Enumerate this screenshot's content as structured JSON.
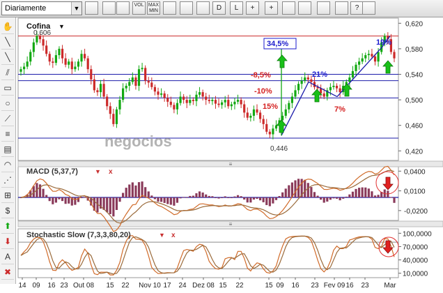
{
  "toolbar": {
    "period": "Diariamente",
    "buttons": [
      {
        "name": "bar-chart-icon",
        "text": ""
      },
      {
        "name": "candlestick-icon",
        "text": ""
      },
      {
        "name": "line-chart-icon",
        "text": ""
      },
      {
        "name": "volume-button",
        "text": "VOL"
      },
      {
        "name": "max-min-button",
        "text": "MAX MIN"
      },
      {
        "name": "grid-icon",
        "text": ""
      },
      {
        "name": "log-scale-icon",
        "text": ""
      },
      {
        "name": "calendar-icon",
        "text": ""
      },
      {
        "name": "draw-d-button",
        "text": "D"
      },
      {
        "name": "draw-l-button",
        "text": "L"
      },
      {
        "name": "crosshair-icon",
        "text": "+"
      },
      {
        "name": "crosshair-label-icon",
        "text": "+"
      },
      {
        "name": "trend-icon",
        "text": ""
      },
      {
        "name": "zoom-in-icon",
        "text": ""
      },
      {
        "name": "zoom-out-icon",
        "text": ""
      },
      {
        "name": "print-icon",
        "text": ""
      },
      {
        "name": "help-icon",
        "text": "?"
      },
      {
        "name": "book-icon",
        "text": ""
      }
    ]
  },
  "sidetools": [
    "hand-icon",
    "line-icon",
    "ray-icon",
    "parallel-lines-icon",
    "rectangle-icon",
    "circle-icon",
    "fibonacci-fan-icon",
    "fibonacci-retracement-icon",
    "fibonacci-levels-icon",
    "arc-icon",
    "speed-lines-icon",
    "gann-icon",
    "dollar-icon",
    "buy-arrow-icon",
    "sell-arrow-icon",
    "text-icon",
    "delete-icon"
  ],
  "price_panel": {
    "symbol": "Cofina",
    "max_label": "0,606",
    "min_label": "0,446",
    "watermark": "negocios",
    "annotations": {
      "gain_total": "34,5%",
      "gain_recent": "19%",
      "gain_rebound": "21%",
      "dip_7": "7%",
      "fall_85": "-8,5%",
      "fall_10": "-10%",
      "fall_15": "15%"
    }
  },
  "macd_panel": {
    "title": "MACD (5,37,7)"
  },
  "stoch_panel": {
    "title": "Stochastic Slow (7,3,3,80,20)"
  },
  "chart_data": [
    {
      "type": "candlestick",
      "title": "Cofina",
      "ylim": [
        0.405,
        0.628
      ],
      "yticks": [
        "0,420",
        "0,460",
        "0,500",
        "0,540",
        "0,580",
        "0,620"
      ],
      "xticks": [
        "14",
        "09",
        "16",
        "23",
        "Out 08",
        "15",
        "22",
        "Nov 10",
        "17",
        "24",
        "Dez 08",
        "15",
        "22",
        "15",
        "09",
        "16",
        "23",
        "Fev 09",
        "16",
        "23",
        "Mar"
      ],
      "horizontal_lines": [
        0.6,
        0.54,
        0.53,
        0.503,
        0.44
      ],
      "close": [
        0.548,
        0.552,
        0.56,
        0.575,
        0.59,
        0.6,
        0.595,
        0.585,
        0.572,
        0.56,
        0.558,
        0.57,
        0.58,
        0.565,
        0.555,
        0.56,
        0.548,
        0.552,
        0.56,
        0.572,
        0.565,
        0.548,
        0.532,
        0.515,
        0.512,
        0.525,
        0.505,
        0.49,
        0.478,
        0.462,
        0.485,
        0.5,
        0.518,
        0.522,
        0.528,
        0.535,
        0.522,
        0.548,
        0.55,
        0.53,
        0.527,
        0.52,
        0.513,
        0.508,
        0.51,
        0.503,
        0.497,
        0.492,
        0.485,
        0.495,
        0.505,
        0.5,
        0.495,
        0.5,
        0.498,
        0.508,
        0.512,
        0.505,
        0.5,
        0.498,
        0.5,
        0.494,
        0.492,
        0.496,
        0.5,
        0.49,
        0.493,
        0.497,
        0.5,
        0.493,
        0.48,
        0.472,
        0.475,
        0.485,
        0.48,
        0.47,
        0.462,
        0.45,
        0.446,
        0.455,
        0.46,
        0.468,
        0.475,
        0.485,
        0.495,
        0.505,
        0.515,
        0.525,
        0.53,
        0.535,
        0.532,
        0.528,
        0.52,
        0.518,
        0.51,
        0.505,
        0.515,
        0.52,
        0.522,
        0.518,
        0.512,
        0.522,
        0.528,
        0.535,
        0.545,
        0.555,
        0.56,
        0.565,
        0.57,
        0.572,
        0.568,
        0.56,
        0.575,
        0.59,
        0.6,
        0.595,
        0.575,
        0.565
      ]
    },
    {
      "type": "line",
      "title": "MACD (5,37,7)",
      "ylim": [
        -0.035,
        0.052
      ],
      "yticks": [
        "0,0400",
        "0,0100",
        "-0,0200"
      ]
    },
    {
      "type": "line",
      "title": "Stochastic Slow (7,3,3,80,20)",
      "ylim": [
        0,
        110
      ],
      "yticks": [
        "100,0000",
        "70,0000",
        "40,0000",
        "10,0000"
      ],
      "levels": [
        80,
        20
      ]
    }
  ],
  "colors": {
    "up": "#12a812",
    "down": "#cc2a2a",
    "hline_red": "#cc2a2a",
    "hline_blue": "#1b1baa",
    "label_red": "#d42020",
    "label_blue": "#1a1acc",
    "macd_line": "#d06a28",
    "signal_line": "#9a6a3a",
    "histogram": "#8a3a5a"
  }
}
